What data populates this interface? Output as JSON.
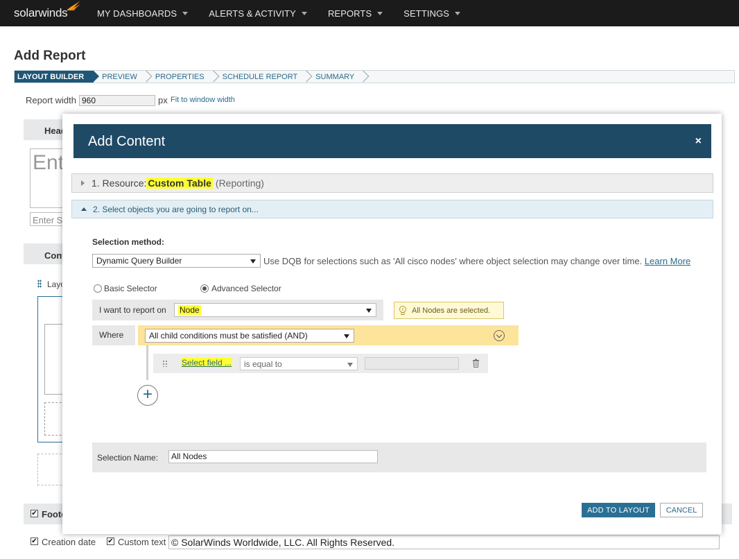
{
  "topnav": {
    "logo_text": "solarwinds",
    "items": [
      {
        "label": "MY DASHBOARDS"
      },
      {
        "label": "ALERTS & ACTIVITY"
      },
      {
        "label": "REPORTS"
      },
      {
        "label": "SETTINGS"
      }
    ]
  },
  "page": {
    "title": "Add Report",
    "wizard_steps": [
      "LAYOUT BUILDER",
      "PREVIEW",
      "PROPERTIES",
      "SCHEDULE REPORT",
      "SUMMARY"
    ],
    "report_width_label": "Report width",
    "report_width_value": "960",
    "report_width_unit": "px",
    "fit_link": "Fit to window width",
    "header_label": "Head",
    "title_placeholder": "Ent",
    "subtitle_placeholder": "Enter S",
    "content_label": "Cont",
    "layout_label": "Layo",
    "footer_label": "Foote",
    "creation_date_label": "Creation date",
    "custom_text_label": "Custom text",
    "custom_text_value": "© SolarWinds Worldwide, LLC. All Rights Reserved."
  },
  "modal": {
    "title": "Add Content",
    "close_glyph": "×",
    "section1": {
      "prefix": "1. Resource:",
      "resource": "Custom Table",
      "suffix": "(Reporting)"
    },
    "section2": {
      "label": "2. Select objects you are going to report on..."
    },
    "selection_method_label": "Selection method:",
    "selection_method_value": "Dynamic Query Builder",
    "dqb_help": "Use DQB for selections such as 'All cisco nodes' where object selection may change over time.",
    "learn_more": "Learn More",
    "basic_selector": "Basic Selector",
    "advanced_selector": "Advanced Selector",
    "report_on_label": "I want to report on",
    "report_on_value": "Node",
    "hint": "All Nodes are selected.",
    "where_label": "Where",
    "condition_group": "All child conditions must be satisfied (AND)",
    "select_field": "Select field ...",
    "operator": "is equal to",
    "add_glyph": "+",
    "selection_name_label": "Selection Name:",
    "selection_name_value": "All Nodes",
    "add_button": "ADD TO LAYOUT",
    "cancel_button": "CANCEL"
  },
  "colors": {
    "nav_bg": "#1b1b1b",
    "modal_header": "#1e4a66",
    "accent": "#2a6f94",
    "highlight": "#ffff33",
    "group_bar": "#fde49b"
  }
}
